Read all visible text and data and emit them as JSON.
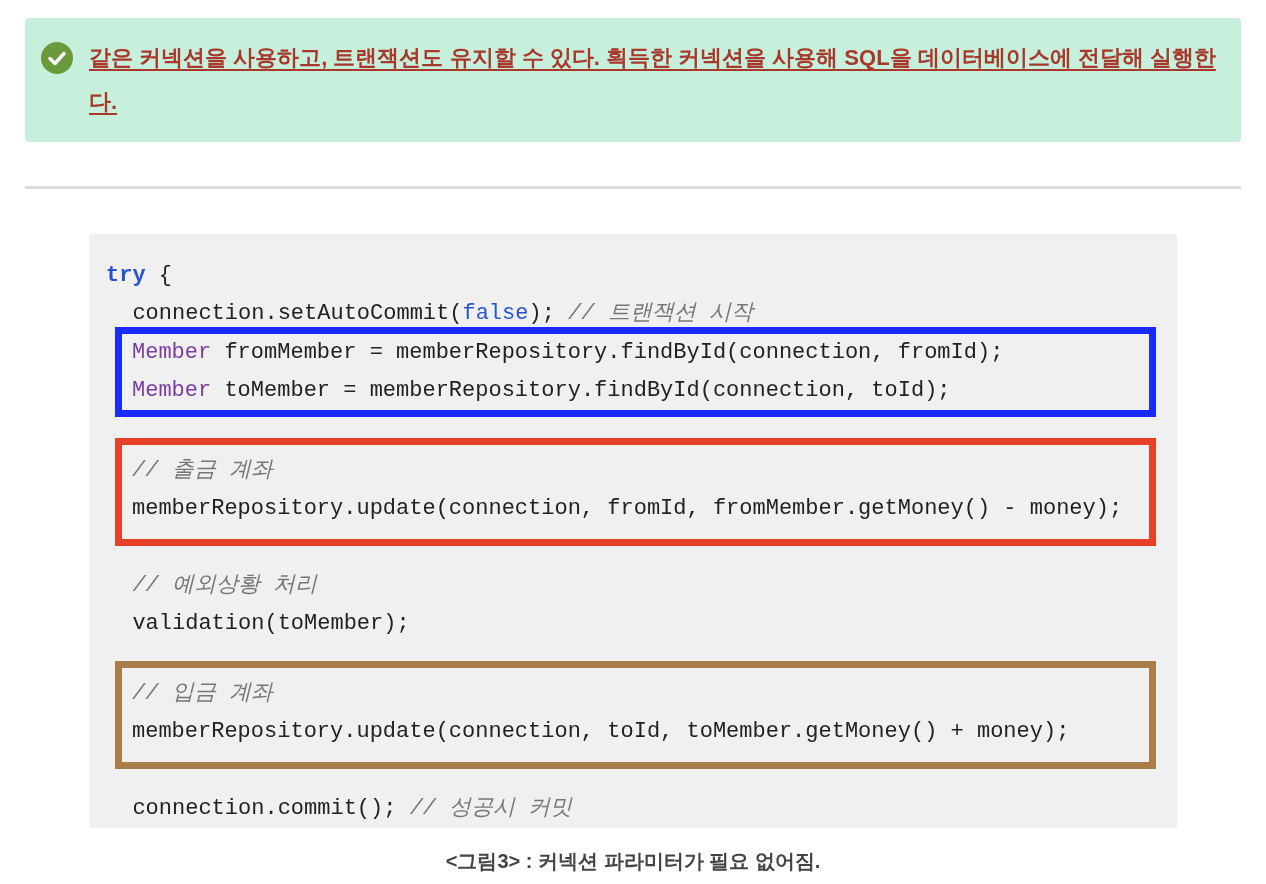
{
  "callout": {
    "text": "같은 커넥션을 사용하고, 트랜잭션도 유지할 수 있다. 획득한 커넥션을 사용해 SQL을 데이터베이스에 전달해 실행한다."
  },
  "code_figure": {
    "groups": [
      {
        "lines": [
          [
            {
              "kind": "keyword",
              "text": "try"
            },
            {
              "kind": "plain",
              "text": " {"
            }
          ],
          [
            {
              "kind": "plain",
              "text": "  connection.setAutoCommit("
            },
            {
              "kind": "literal",
              "text": "false"
            },
            {
              "kind": "plain",
              "text": "); "
            },
            {
              "kind": "comment",
              "text": "// 트랜잭션 시작"
            }
          ]
        ]
      },
      {
        "color": "#1a2bff",
        "lines": [
          [
            {
              "kind": "type",
              "text": "Member"
            },
            {
              "kind": "plain",
              "text": " fromMember = memberRepository.findById(connection, fromId);"
            }
          ],
          [
            {
              "kind": "type",
              "text": "Member"
            },
            {
              "kind": "plain",
              "text": " toMember = memberRepository.findById(connection, toId);"
            }
          ]
        ]
      },
      {
        "color": "#e8412a",
        "lines": [
          [
            {
              "kind": "comment",
              "text": "// 출금 계좌"
            }
          ],
          [
            {
              "kind": "plain",
              "text": "memberRepository.update(connection, fromId, fromMember.getMoney() - money);"
            }
          ]
        ]
      },
      {
        "lines": [
          [
            {
              "kind": "comment",
              "text": "  // 예외상황 처리"
            }
          ],
          [
            {
              "kind": "plain",
              "text": "  validation(toMember);"
            }
          ]
        ]
      },
      {
        "color": "#a87d4a",
        "lines": [
          [
            {
              "kind": "comment",
              "text": "// 입금 계좌"
            }
          ],
          [
            {
              "kind": "plain",
              "text": "memberRepository.update(connection, toId, toMember.getMoney() + money);"
            }
          ]
        ]
      },
      {
        "lines": [
          [
            {
              "kind": "plain",
              "text": "  connection.commit(); "
            },
            {
              "kind": "comment",
              "text": "// 성공시 커밋"
            }
          ]
        ]
      }
    ],
    "caption": "<그림3> : 커넥션 파라미터가 필요 없어짐."
  }
}
